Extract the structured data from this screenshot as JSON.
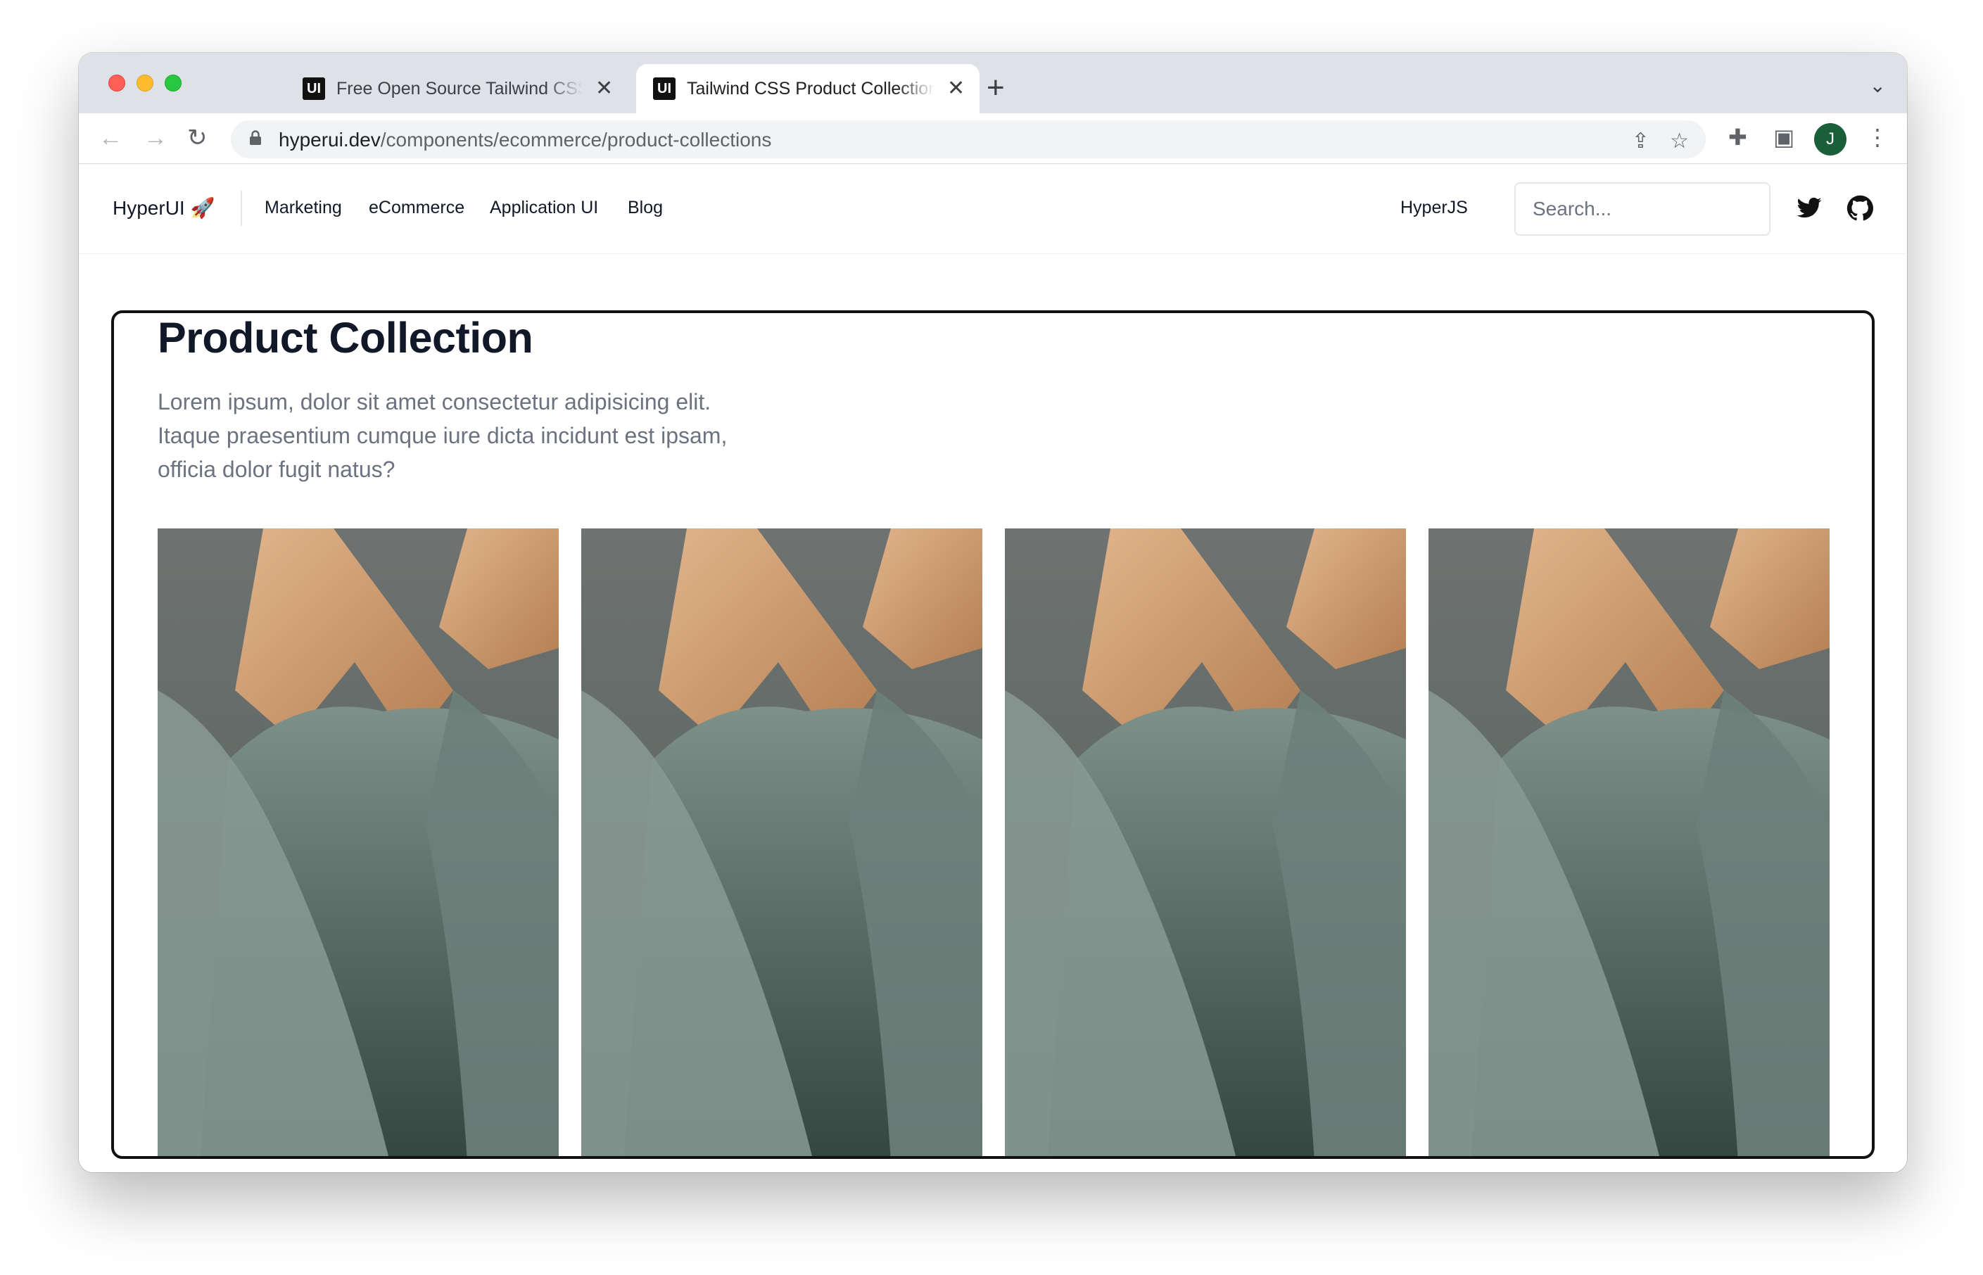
{
  "browser": {
    "tabs": [
      {
        "title": "Free Open Source Tailwind CSS",
        "favicon": "UI",
        "active": false
      },
      {
        "title": "Tailwind CSS Product Collection",
        "favicon": "UI",
        "active": true
      }
    ],
    "url_host": "hyperui.dev",
    "url_path": "/components/ecommerce/product-collections",
    "avatar_initial": "J"
  },
  "site": {
    "brand": "HyperUI 🚀",
    "nav": [
      "Marketing",
      "eCommerce",
      "Application UI",
      "Blog"
    ],
    "hyperjs": "HyperJS",
    "search_placeholder": "Search..."
  },
  "preview": {
    "title": "Product Collection",
    "description": "Lorem ipsum, dolor sit amet consectetur adipisicing elit. Itaque praesentium cumque iure dicta incidunt est ipsam, officia dolor fugit natus?",
    "products": [
      {
        "image": "green-tshirts-on-hangers"
      },
      {
        "image": "green-tshirts-on-hangers"
      },
      {
        "image": "green-tshirts-on-hangers"
      },
      {
        "image": "green-tshirts-on-hangers"
      }
    ]
  },
  "colors": {
    "accent_dark": "#111827",
    "muted_text": "#6b7280",
    "avatar_bg": "#1b5e3a"
  }
}
